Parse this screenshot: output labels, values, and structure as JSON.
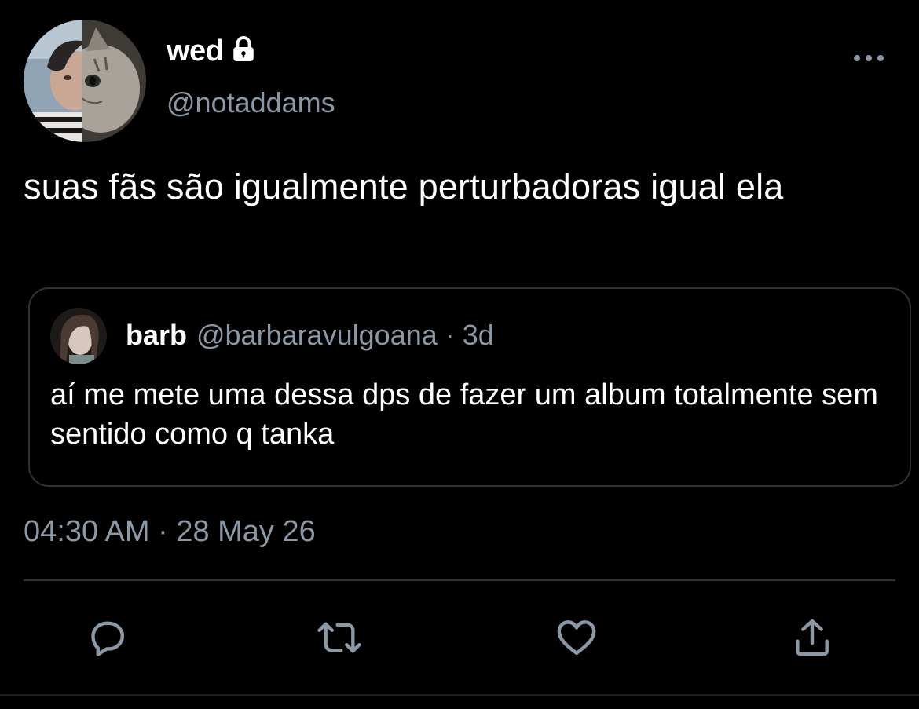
{
  "tweet": {
    "author": {
      "display_name": "wed",
      "handle": "@notaddams",
      "protected_icon": "lock-icon"
    },
    "text": "suas fãs são igualmente perturbadoras igual ela",
    "timestamp": "04:30 AM · 28 May 26"
  },
  "quoted_tweet": {
    "display_name": "barb",
    "meta": "@barbaravulgoana · 3d",
    "text": "aí me mete uma dessa dps de fazer um album totalmente sem sentido como q tanka"
  },
  "actions": [
    {
      "name": "reply",
      "icon": "reply-icon"
    },
    {
      "name": "retweet",
      "icon": "retweet-icon"
    },
    {
      "name": "like",
      "icon": "heart-icon"
    },
    {
      "name": "share",
      "icon": "share-icon"
    }
  ],
  "colors": {
    "background": "#000000",
    "primary_text": "#ffffff",
    "secondary_text": "#8b98a5",
    "border": "#2f3336"
  }
}
